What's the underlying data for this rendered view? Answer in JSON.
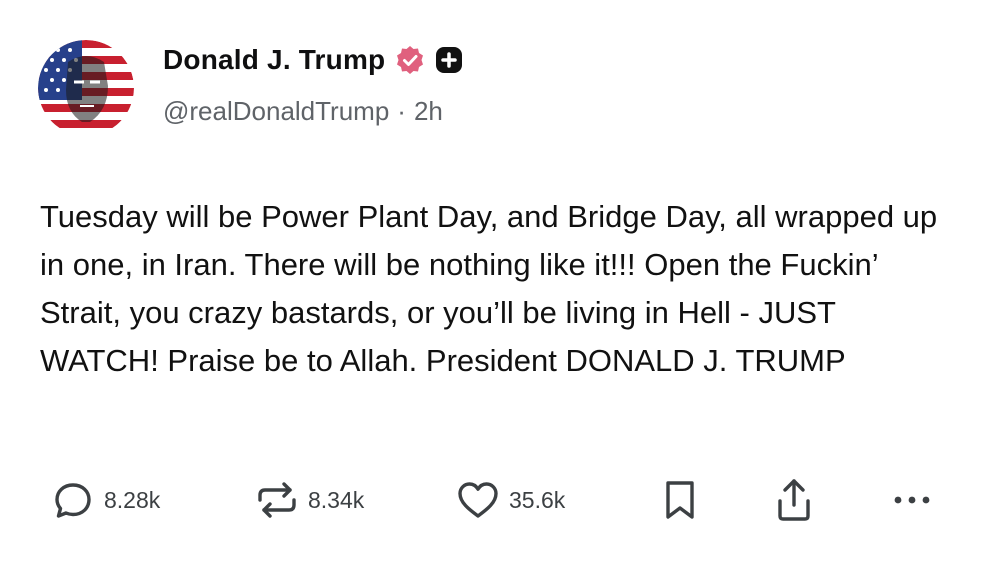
{
  "author": {
    "display_name": "Donald J. Trump",
    "handle": "@realDonaldTrump",
    "separator": "·",
    "time_ago": "2h",
    "verified_badge_color": "#e0607e",
    "plus_badge_color": "#111111"
  },
  "post": {
    "text": "Tuesday will be Power Plant Day, and Bridge Day, all wrapped up in one, in Iran. There will be nothing like it!!! Open the Fuckin’ Strait, you crazy bastards, or you’ll be living in Hell - JUST WATCH! Praise be to Allah. President DONALD J. TRUMP"
  },
  "actions": {
    "replies": {
      "icon": "reply-icon",
      "count": "8.28k"
    },
    "reposts": {
      "icon": "repost-icon",
      "count": "8.34k"
    },
    "likes": {
      "icon": "heart-icon",
      "count": "35.6k"
    },
    "bookmark": {
      "icon": "bookmark-icon"
    },
    "share": {
      "icon": "share-icon"
    },
    "more": {
      "icon": "more-icon"
    }
  },
  "colors": {
    "text": "#111111",
    "muted": "#5f6368",
    "icon": "#3c4043"
  }
}
